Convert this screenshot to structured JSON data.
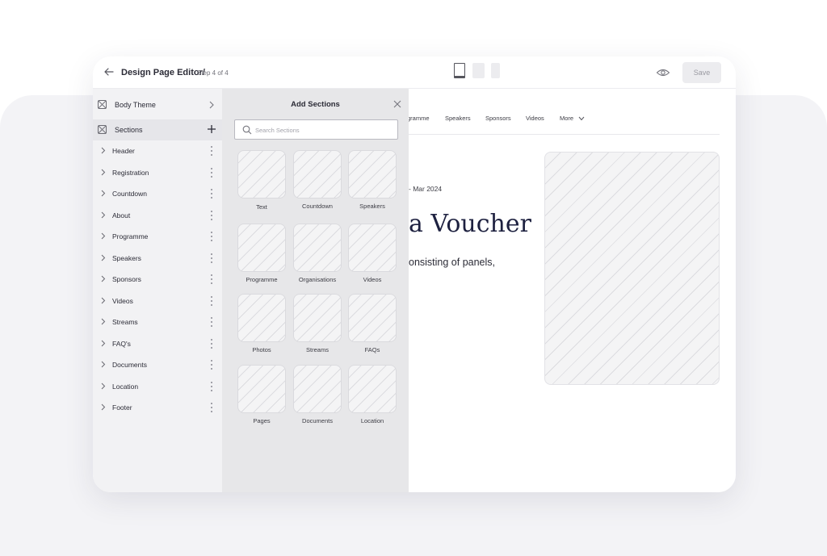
{
  "topbar": {
    "title": "Design Page Editor/",
    "step": "Step 4 of 4",
    "save_label": "Save"
  },
  "sidebar": {
    "body_theme_label": "Body Theme",
    "sections_label": "Sections",
    "items": [
      {
        "label": "Header"
      },
      {
        "label": "Registration"
      },
      {
        "label": "Countdown"
      },
      {
        "label": "About"
      },
      {
        "label": "Programme"
      },
      {
        "label": "Speakers"
      },
      {
        "label": "Sponsors"
      },
      {
        "label": "Videos"
      },
      {
        "label": "Streams"
      },
      {
        "label": "FAQ's"
      },
      {
        "label": "Documents"
      },
      {
        "label": "Location"
      },
      {
        "label": "Footer"
      }
    ]
  },
  "add_sections": {
    "title": "Add Sections",
    "search_placeholder": "Search Sections",
    "tiles": [
      {
        "label": "Text"
      },
      {
        "label": "Countdown"
      },
      {
        "label": "Speakers"
      },
      {
        "label": "Programme"
      },
      {
        "label": "Organisations"
      },
      {
        "label": "Videos"
      },
      {
        "label": "Photos"
      },
      {
        "label": "Streams"
      },
      {
        "label": "FAQs"
      },
      {
        "label": "Pages"
      },
      {
        "label": "Documents"
      },
      {
        "label": "Location"
      }
    ]
  },
  "preview": {
    "nav": [
      "gramme",
      "Speakers",
      "Sponsors",
      "Videos",
      "More"
    ],
    "date_text": "- Mar 2024",
    "headline": "a Voucher",
    "subtext": "onsisting of panels,"
  }
}
